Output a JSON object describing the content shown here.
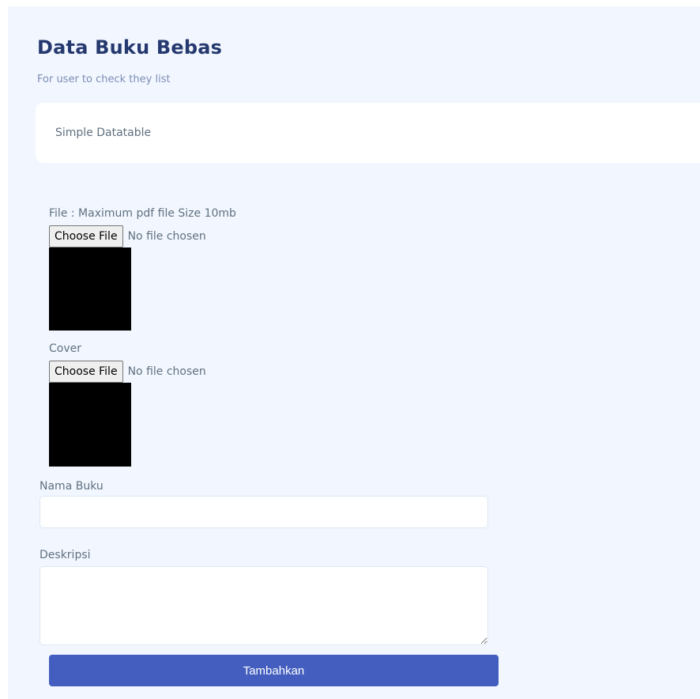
{
  "page": {
    "title": "Data Buku Bebas",
    "subtitle": "For user to check they list"
  },
  "card": {
    "title": "Simple Datatable"
  },
  "form": {
    "file_label": "File : Maximum pdf file Size 10mb",
    "file_button": "Choose File",
    "file_status": "No file chosen",
    "cover_label": "Cover",
    "cover_button": "Choose File",
    "cover_status": "No file chosen",
    "name_label": "Nama Buku",
    "name_value": "",
    "description_label": "Deskripsi",
    "description_value": "",
    "submit_label": "Tambahkan"
  },
  "colors": {
    "background": "#f2f7ff",
    "heading": "#25396f",
    "primary": "#435ebe"
  }
}
